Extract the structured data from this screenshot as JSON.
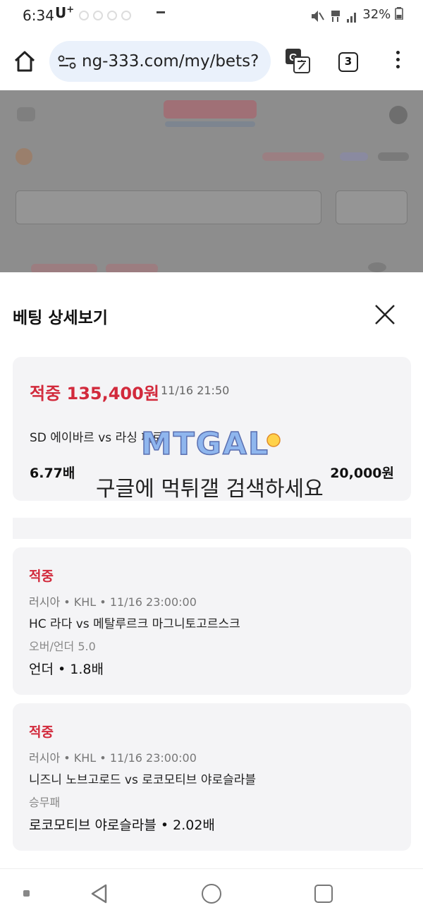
{
  "status_bar": {
    "time": "6:34",
    "carrier": "U",
    "carrier_sup": "+",
    "battery": "32%"
  },
  "browser": {
    "url": "ng-333.com/my/bets?",
    "tab_count": "3",
    "icons": [
      "home-icon",
      "site-info-icon",
      "translate-icon",
      "more-vert-icon"
    ]
  },
  "sheet": {
    "title": "베팅 상세보기",
    "summary": {
      "result": "적중 135,400원",
      "time": "11/16 21:50",
      "match": "SD 에이바르 vs 라싱 페로",
      "odds": "6.77배",
      "stake": "20,000원"
    },
    "bets": [
      {
        "status": "적중",
        "meta": "러시아 • KHL • 11/16 23:00:00",
        "teams": "HC 라다 vs 메탈루르크 마그니토고르스크",
        "market": "오버/언더 5.0",
        "pick": "언더 • 1.8배"
      },
      {
        "status": "적중",
        "meta": "러시아 • KHL • 11/16 23:00:00",
        "teams": "니즈니 노브고로드 vs 로코모티브 야로슬라블",
        "market": "승무패",
        "pick": "로코모티브 야로슬라블 • 2.02배"
      }
    ]
  },
  "watermark": {
    "logo": "MTGAL",
    "text": "구글에 먹튀갤 검색하세요"
  },
  "colors": {
    "accent_red": "#d22a3c",
    "card_bg": "#f4f4f6",
    "url_bg": "#eaf1fb"
  }
}
